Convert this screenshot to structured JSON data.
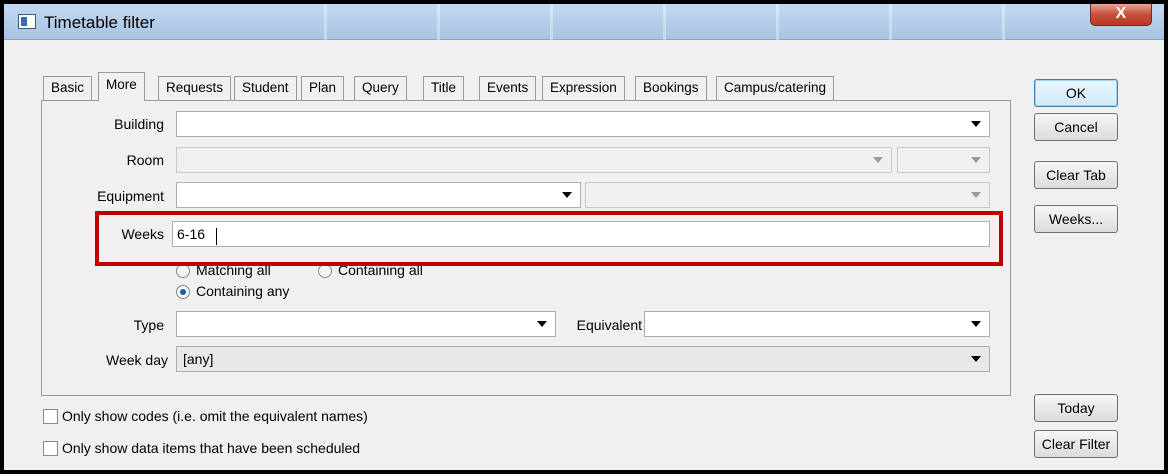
{
  "window": {
    "title": "Timetable filter",
    "close_label": "X"
  },
  "tabs": [
    {
      "label": "Basic",
      "active": false
    },
    {
      "label": "More",
      "active": true
    },
    {
      "label": "Requests",
      "active": false
    },
    {
      "label": "Student",
      "active": false
    },
    {
      "label": "Plan",
      "active": false
    },
    {
      "label": "Query",
      "active": false
    },
    {
      "label": "Title",
      "active": false
    },
    {
      "label": "Events",
      "active": false
    },
    {
      "label": "Expression",
      "active": false
    },
    {
      "label": "Bookings",
      "active": false
    },
    {
      "label": "Campus/catering",
      "active": false
    }
  ],
  "form": {
    "building": {
      "label": "Building",
      "value": ""
    },
    "room": {
      "label": "Room",
      "value": "",
      "secondary_value": ""
    },
    "equipment": {
      "label": "Equipment",
      "value": "",
      "secondary_value": ""
    },
    "weeks": {
      "label": "Weeks",
      "value": "6-16"
    },
    "match_options": {
      "matching_all": "Matching all",
      "containing_all": "Containing all",
      "containing_any": "Containing any",
      "selected": "containing_any"
    },
    "type": {
      "label": "Type",
      "value": ""
    },
    "equivalent": {
      "label": "Equivalent",
      "value": ""
    },
    "week_day": {
      "label": "Week day",
      "value": "[any]"
    }
  },
  "checkboxes": {
    "only_codes": {
      "label": "Only show codes (i.e. omit the equivalent names)",
      "checked": false
    },
    "only_scheduled": {
      "label": "Only show data items that have been scheduled",
      "checked": false
    }
  },
  "buttons": {
    "ok": "OK",
    "cancel": "Cancel",
    "clear_tab": "Clear Tab",
    "weeks": "Weeks...",
    "today": "Today",
    "clear_filter": "Clear Filter"
  },
  "colors": {
    "highlight": "#c00000",
    "accent": "#1c5fb0"
  }
}
